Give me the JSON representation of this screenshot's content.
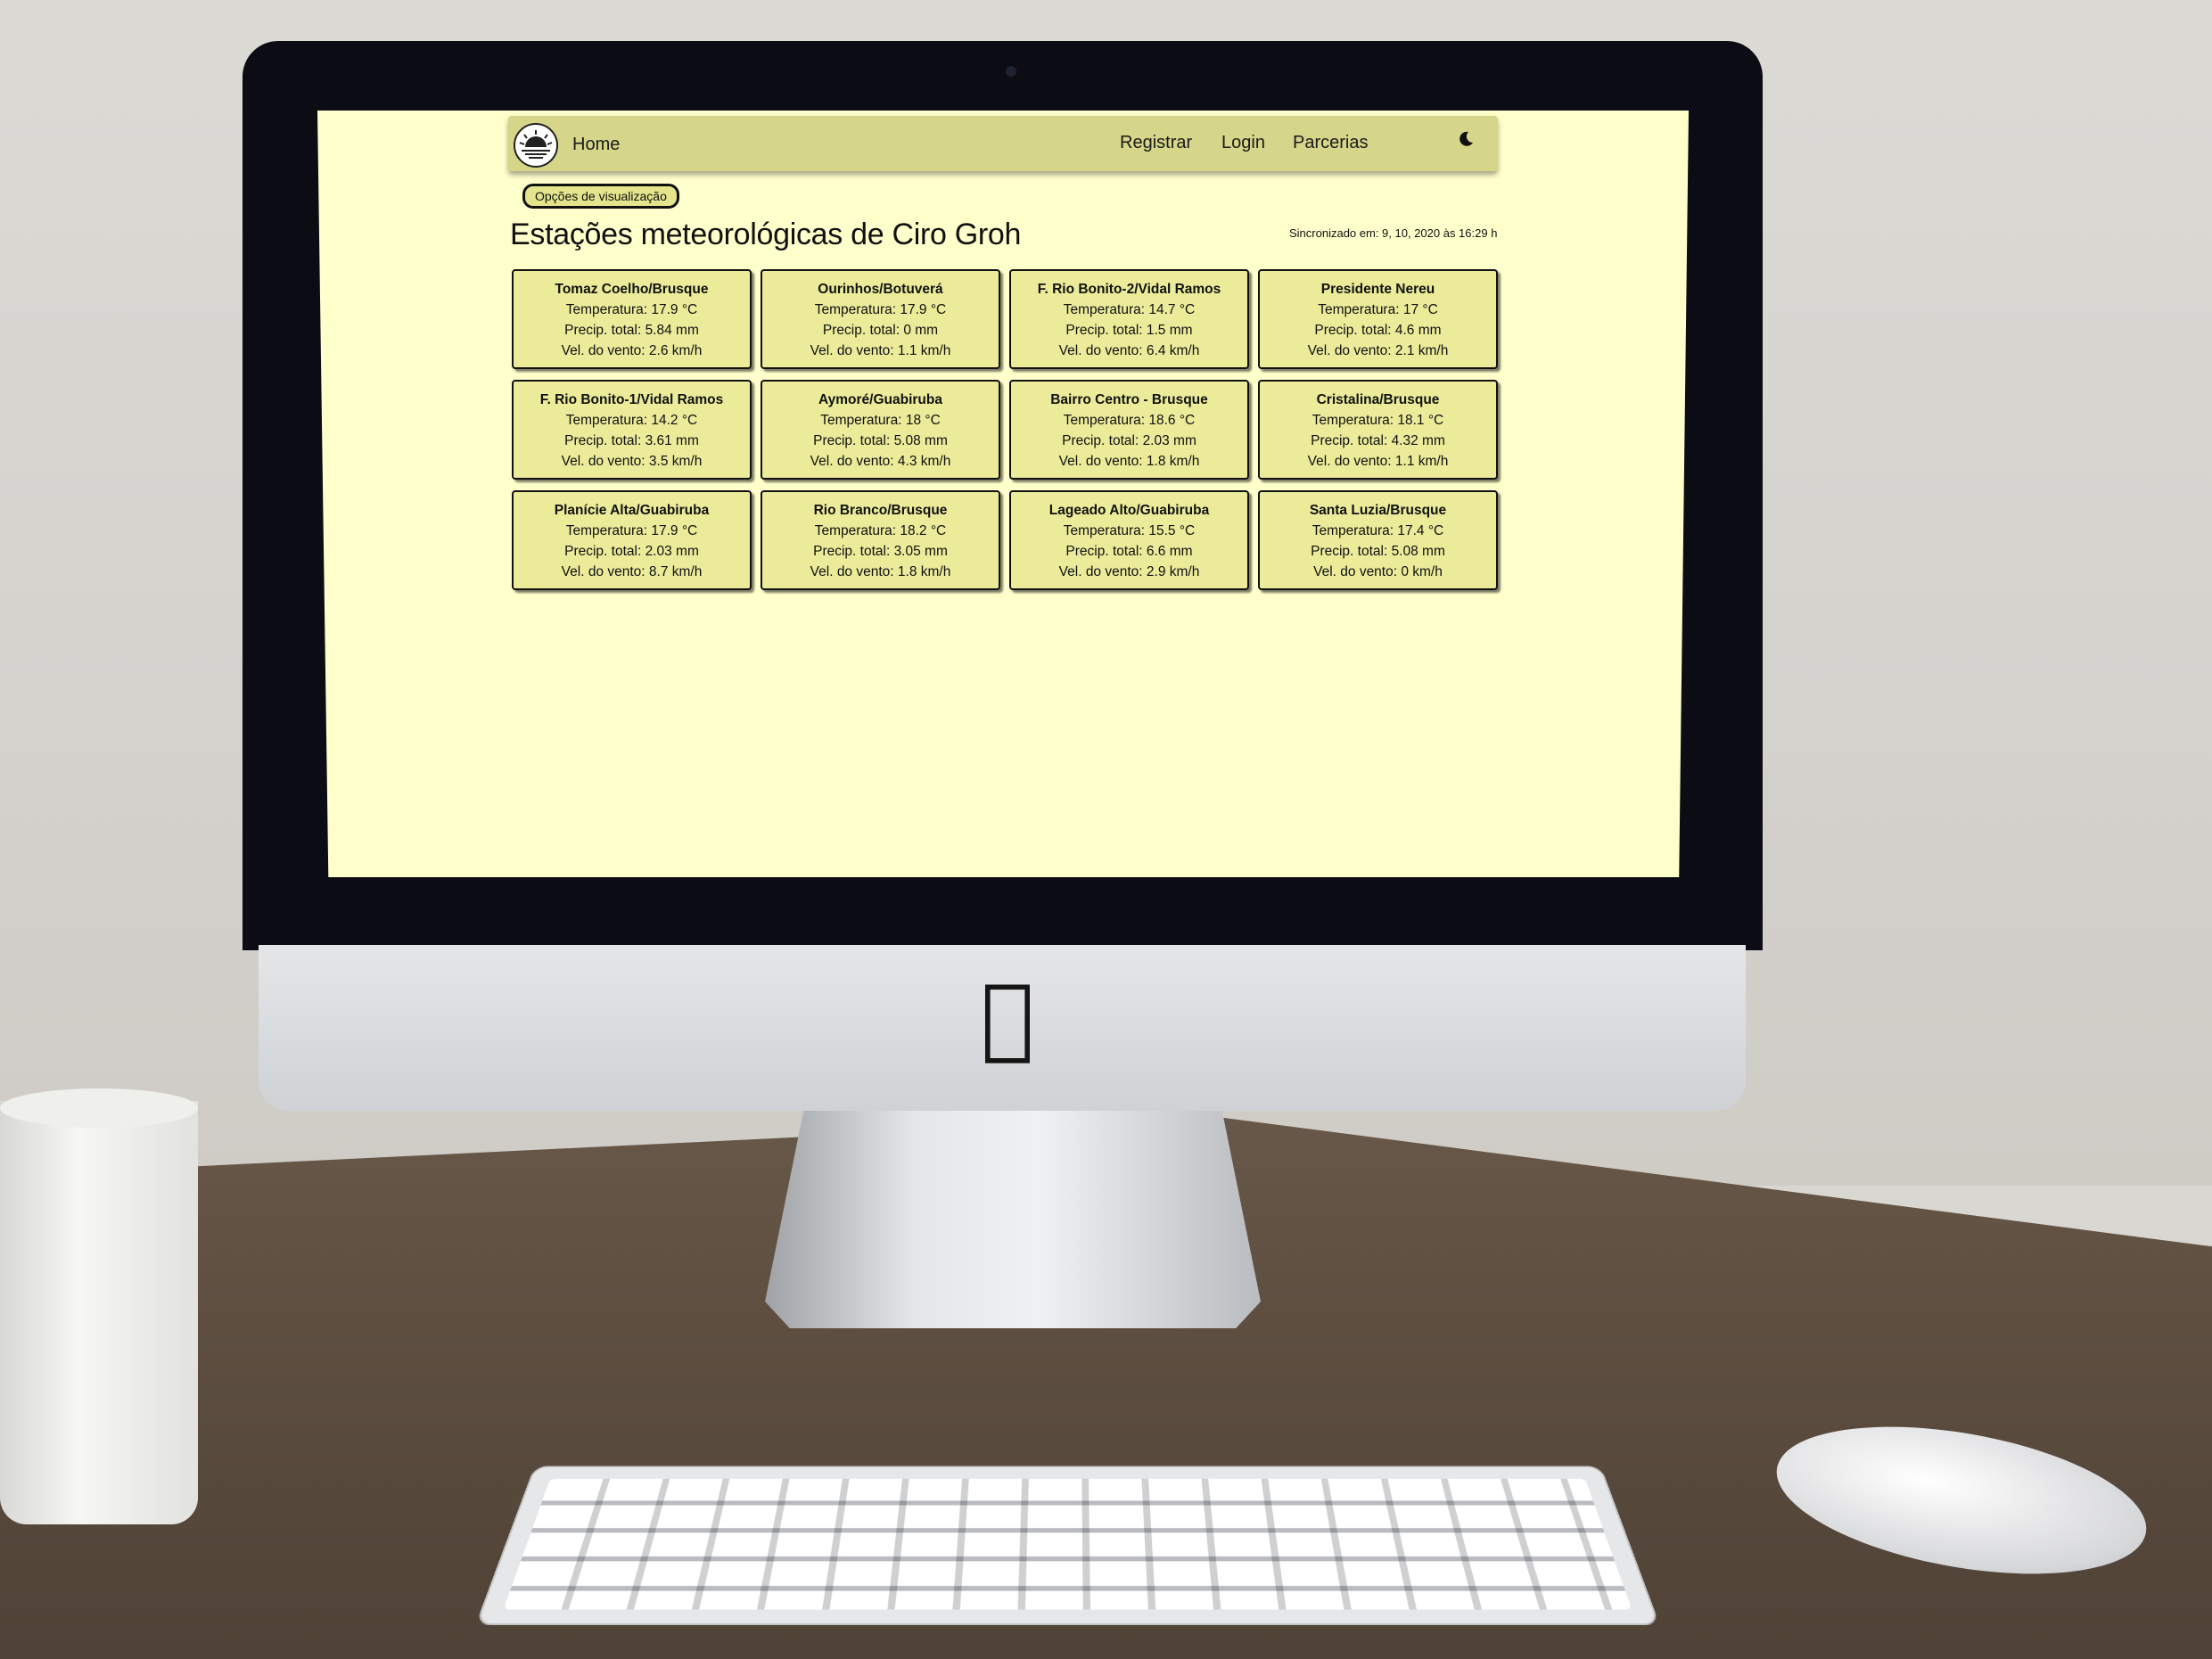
{
  "nav": {
    "home_label": "Home",
    "links": [
      "Registrar",
      "Login",
      "Parcerias"
    ],
    "theme_icon": "moon-icon",
    "logo_icon": "sunrise-logo-icon"
  },
  "view_options_label": "Opções de visualização",
  "page_title": "Estações meteorológicas de Ciro Groh",
  "sync_text": "Sincronizado em: 9, 10, 2020 às 16:29 h",
  "stations": [
    {
      "name": "Tomaz Coelho/Brusque",
      "temp": "Temperatura: 17.9 °C",
      "precip": "Precip. total: 5.84 mm",
      "wind": "Vel. do vento: 2.6 km/h"
    },
    {
      "name": "Ourinhos/Botuverá",
      "temp": "Temperatura: 17.9 °C",
      "precip": "Precip. total: 0 mm",
      "wind": "Vel. do vento: 1.1 km/h"
    },
    {
      "name": "F. Rio Bonito-2/Vidal Ramos",
      "temp": "Temperatura: 14.7 °C",
      "precip": "Precip. total: 1.5 mm",
      "wind": "Vel. do vento: 6.4 km/h"
    },
    {
      "name": "Presidente Nereu",
      "temp": "Temperatura: 17 °C",
      "precip": "Precip. total: 4.6 mm",
      "wind": "Vel. do vento: 2.1 km/h"
    },
    {
      "name": "F. Rio Bonito-1/Vidal Ramos",
      "temp": "Temperatura: 14.2 °C",
      "precip": "Precip. total: 3.61 mm",
      "wind": "Vel. do vento: 3.5 km/h"
    },
    {
      "name": "Aymoré/Guabiruba",
      "temp": "Temperatura: 18 °C",
      "precip": "Precip. total: 5.08 mm",
      "wind": "Vel. do vento: 4.3 km/h"
    },
    {
      "name": "Bairro Centro - Brusque",
      "temp": "Temperatura: 18.6 °C",
      "precip": "Precip. total: 2.03 mm",
      "wind": "Vel. do vento: 1.8 km/h"
    },
    {
      "name": "Cristalina/Brusque",
      "temp": "Temperatura: 18.1 °C",
      "precip": "Precip. total: 4.32 mm",
      "wind": "Vel. do vento: 1.1 km/h"
    },
    {
      "name": "Planície Alta/Guabiruba",
      "temp": "Temperatura: 17.9 °C",
      "precip": "Precip. total: 2.03 mm",
      "wind": "Vel. do vento: 8.7 km/h"
    },
    {
      "name": "Rio Branco/Brusque",
      "temp": "Temperatura: 18.2 °C",
      "precip": "Precip. total: 3.05 mm",
      "wind": "Vel. do vento: 1.8 km/h"
    },
    {
      "name": "Lageado Alto/Guabiruba",
      "temp": "Temperatura: 15.5 °C",
      "precip": "Precip. total: 6.6 mm",
      "wind": "Vel. do vento: 2.9 km/h"
    },
    {
      "name": "Santa Luzia/Brusque",
      "temp": "Temperatura: 17.4 °C",
      "precip": "Precip. total: 5.08 mm",
      "wind": "Vel. do vento: 0 km/h"
    }
  ],
  "colors": {
    "page_bg": "#ffffcc",
    "navbar": "#d6d68a",
    "card": "#ebeb9a"
  }
}
